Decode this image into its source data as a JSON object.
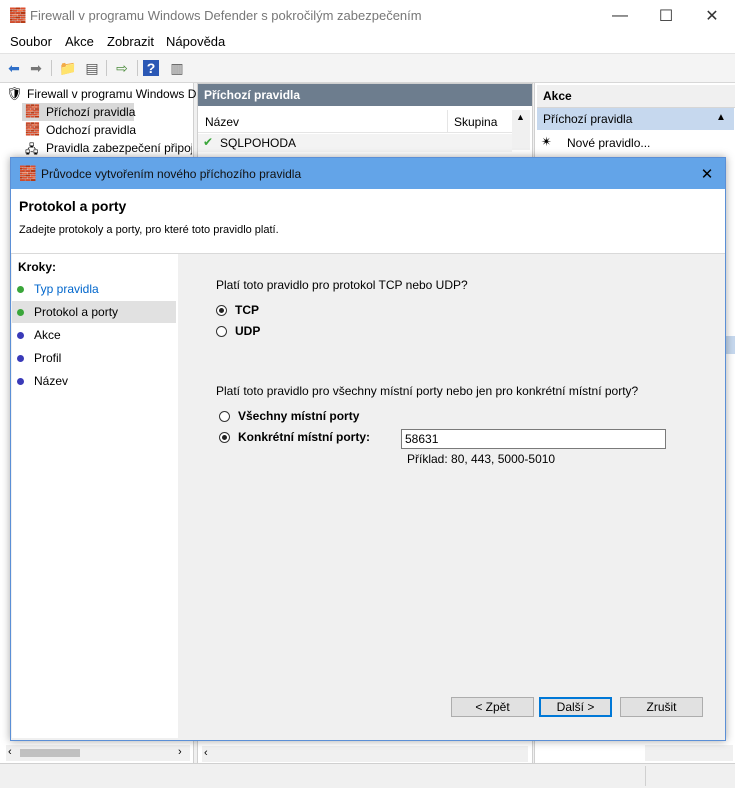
{
  "window": {
    "title": "Firewall v programu Windows Defender s pokročilým zabezpečením",
    "menu": [
      "Soubor",
      "Akce",
      "Zobrazit",
      "Nápověda"
    ]
  },
  "tree": {
    "root": "Firewall v programu Windows D",
    "items": [
      "Příchozí pravidla",
      "Odchozí pravidla",
      "Pravidla zabezpečení připoje"
    ]
  },
  "middle": {
    "header": "Příchozí pravidla",
    "columns": [
      "Název",
      "Skupina"
    ],
    "rows": [
      "SQLPOHODA"
    ]
  },
  "actions_pane": {
    "header": "Akce",
    "section": "Příchozí pravidla",
    "items": [
      "Nové pravidlo..."
    ]
  },
  "dialog": {
    "title": "Průvodce vytvořením nového příchozího pravidla",
    "heading": "Protokol a porty",
    "subheading": "Zadejte protokoly a porty, pro které toto pravidlo platí.",
    "steps_label": "Kroky:",
    "steps": [
      {
        "label": "Typ pravidla",
        "status": "done",
        "color": "#3aa63a"
      },
      {
        "label": "Protokol a porty",
        "status": "current",
        "color": "#3aa63a"
      },
      {
        "label": "Akce",
        "status": "pending",
        "color": "#3a3ab8"
      },
      {
        "label": "Profil",
        "status": "pending",
        "color": "#3a3ab8"
      },
      {
        "label": "Název",
        "status": "pending",
        "color": "#3a3ab8"
      }
    ],
    "protocol_question": "Platí toto pravidlo pro protokol TCP nebo UDP?",
    "protocol_options": [
      {
        "label": "TCP",
        "selected": true
      },
      {
        "label": "UDP",
        "selected": false
      }
    ],
    "ports_question": "Platí toto pravidlo pro všechny místní porty nebo jen pro konkrétní místní porty?",
    "port_options": [
      {
        "label": "Všechny místní porty",
        "selected": false
      },
      {
        "label": "Konkrétní místní porty:",
        "selected": true
      }
    ],
    "ports_value": "58631",
    "ports_example": "Příklad: 80, 443, 5000-5010",
    "buttons": {
      "back": "< Zpět",
      "next": "Další >",
      "cancel": "Zrušit"
    }
  }
}
